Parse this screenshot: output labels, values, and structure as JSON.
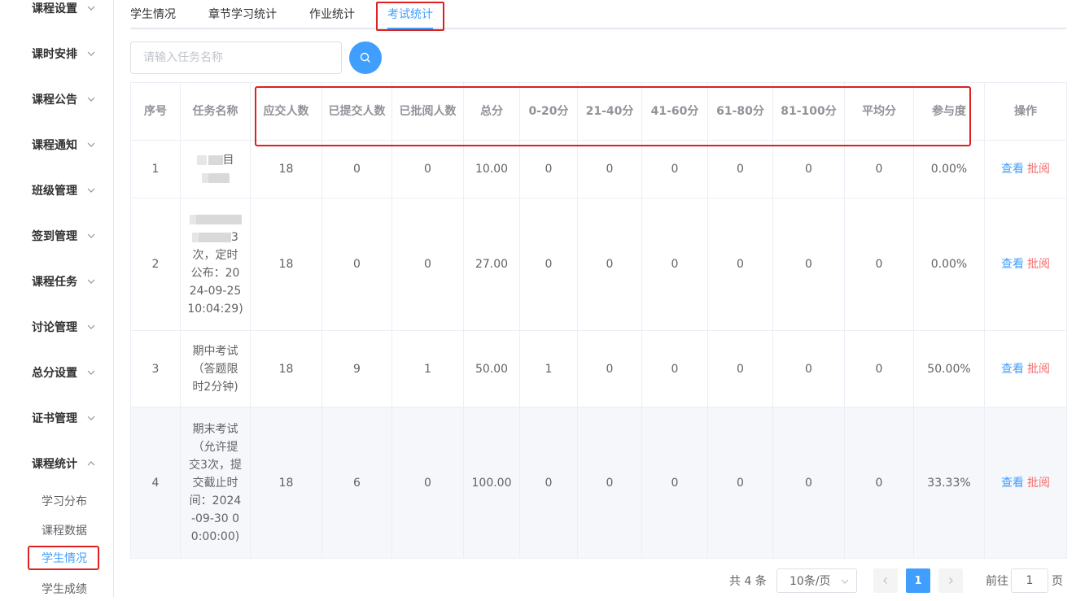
{
  "sidebar": {
    "menus": [
      {
        "label": "课程设置",
        "expanded": false
      },
      {
        "label": "课时安排",
        "expanded": false
      },
      {
        "label": "课程公告",
        "expanded": false
      },
      {
        "label": "课程通知",
        "expanded": false
      },
      {
        "label": "班级管理",
        "expanded": false
      },
      {
        "label": "签到管理",
        "expanded": false
      },
      {
        "label": "课程任务",
        "expanded": false
      },
      {
        "label": "讨论管理",
        "expanded": false
      },
      {
        "label": "总分设置",
        "expanded": false
      },
      {
        "label": "证书管理",
        "expanded": false
      },
      {
        "label": "课程统计",
        "expanded": true
      }
    ],
    "submenu": [
      {
        "label": "学习分布",
        "active": false
      },
      {
        "label": "课程数据",
        "active": false
      },
      {
        "label": "学生情况",
        "active": true
      },
      {
        "label": "学生成绩",
        "active": false
      }
    ]
  },
  "tabs": [
    {
      "label": "学生情况",
      "active": false
    },
    {
      "label": "章节学习统计",
      "active": false
    },
    {
      "label": "作业统计",
      "active": false
    },
    {
      "label": "考试统计",
      "active": true
    }
  ],
  "search": {
    "placeholder": "请输入任务名称",
    "value": ""
  },
  "table": {
    "headers": {
      "index": "序号",
      "task_name": "任务名称",
      "should_submit": "应交人数",
      "submitted": "已提交人数",
      "graded": "已批阅人数",
      "total_score": "总分",
      "r0_20": "0-20分",
      "r21_40": "21-40分",
      "r41_60": "41-60分",
      "r61_80": "61-80分",
      "r81_100": "81-100分",
      "average": "平均分",
      "participation": "参与度",
      "actions": "操作"
    },
    "rows": [
      {
        "index": "1",
        "name_lines": [
          "目"
        ],
        "should_submit": "18",
        "submitted": "0",
        "graded": "0",
        "total_score": "10.00",
        "r0_20": "0",
        "r21_40": "0",
        "r41_60": "0",
        "r61_80": "0",
        "r81_100": "0",
        "average": "0",
        "participation": "0.00%",
        "view": "查看",
        "grade": "批阅"
      },
      {
        "index": "2",
        "name_lines": [
          "3",
          "次，定时",
          "公布：20",
          "24-09-25",
          "10:04:29)"
        ],
        "should_submit": "18",
        "submitted": "0",
        "graded": "0",
        "total_score": "27.00",
        "r0_20": "0",
        "r21_40": "0",
        "r41_60": "0",
        "r61_80": "0",
        "r81_100": "0",
        "average": "0",
        "participation": "0.00%",
        "view": "查看",
        "grade": "批阅"
      },
      {
        "index": "3",
        "name_lines": [
          "期中考试",
          "（答题限",
          "时2分钟)"
        ],
        "should_submit": "18",
        "submitted": "9",
        "graded": "1",
        "total_score": "50.00",
        "r0_20": "1",
        "r21_40": "0",
        "r41_60": "0",
        "r61_80": "0",
        "r81_100": "0",
        "average": "0",
        "participation": "50.00%",
        "view": "查看",
        "grade": "批阅"
      },
      {
        "index": "4",
        "name_lines": [
          "期末考试",
          "（允许提",
          "交3次，提",
          "交截止时",
          "间：2024",
          "-09-30 0",
          "0:00:00)"
        ],
        "should_submit": "18",
        "submitted": "6",
        "graded": "0",
        "total_score": "100.00",
        "r0_20": "0",
        "r21_40": "0",
        "r41_60": "0",
        "r61_80": "0",
        "r81_100": "0",
        "average": "0",
        "participation": "33.33%",
        "view": "查看",
        "grade": "批阅"
      }
    ]
  },
  "pagination": {
    "total_text": "共 4 条",
    "page_size": "10条/页",
    "current_page": "1",
    "goto_prefix": "前往",
    "goto_value": "1",
    "goto_suffix": "页"
  },
  "colors": {
    "accent": "#409eff",
    "danger": "#f56c6c",
    "highlight_box": "#e02020"
  }
}
